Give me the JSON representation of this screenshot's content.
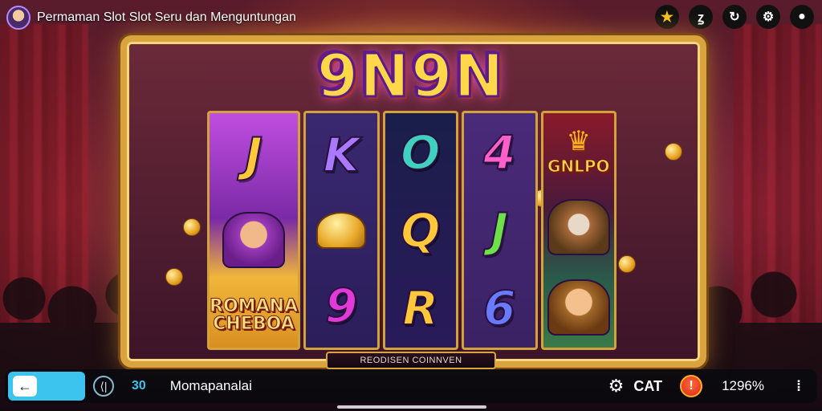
{
  "app": {
    "title": "Permaman Slot Slot Seru dan Menguntungan"
  },
  "top_icons": [
    {
      "name": "star-icon",
      "glyph": "★"
    },
    {
      "name": "profile-icon",
      "glyph": "ꙁ"
    },
    {
      "name": "refresh-icon",
      "glyph": "↻"
    },
    {
      "name": "gear-icon",
      "glyph": "⚙"
    },
    {
      "name": "record-icon",
      "glyph": "●"
    }
  ],
  "game": {
    "logo": "9N9N",
    "plaque": "REODISEN COINNVEN",
    "reels": [
      {
        "top": "J",
        "mid_label": "",
        "bottom_label": "ROMANA CHEBOA"
      },
      {
        "top": "K",
        "mid": "",
        "bottom": "9"
      },
      {
        "top": "O",
        "mid": "Q",
        "bottom": "R"
      },
      {
        "top": "4",
        "mid": "J",
        "bottom": "6"
      },
      {
        "top_label": "GNLPO"
      }
    ]
  },
  "bottombar": {
    "back_glyph": "←",
    "info_glyph": "⟨|",
    "bet": "30",
    "player_name": "Momapanalai",
    "gear_glyph": "⚙",
    "cat_label": "CAT",
    "alert_glyph": "!",
    "percent": "1296%",
    "more_glyph": "⁞"
  },
  "colors": {
    "accent": "#3cc4ee",
    "frame_gold": "#d9a340",
    "logo": "#ffd84a"
  }
}
